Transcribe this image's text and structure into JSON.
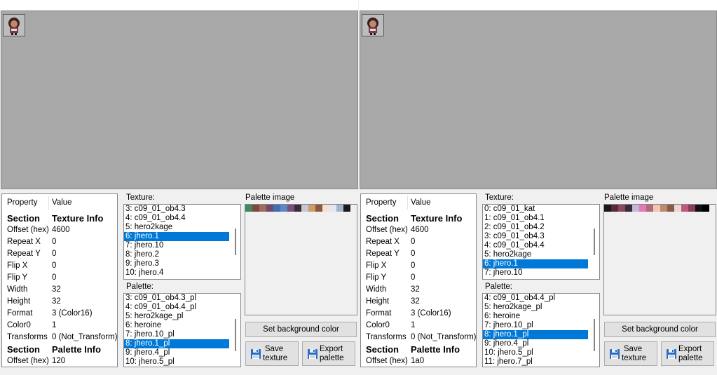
{
  "panes": [
    {
      "properties": {
        "header": {
          "property": "Property",
          "value": "Value"
        },
        "rows": [
          {
            "k": "Section",
            "v": "Texture Info",
            "section": true
          },
          {
            "k": "Offset (hex)",
            "v": "4600"
          },
          {
            "k": "Repeat X",
            "v": "0"
          },
          {
            "k": "Repeat Y",
            "v": "0"
          },
          {
            "k": "Flip X",
            "v": "0"
          },
          {
            "k": "Flip Y",
            "v": "0"
          },
          {
            "k": "Width",
            "v": "32"
          },
          {
            "k": "Height",
            "v": "32"
          },
          {
            "k": "Format",
            "v": "3 (Color16)"
          },
          {
            "k": "Color0",
            "v": "1"
          },
          {
            "k": "Transforms",
            "v": "0 (Not_Transform)"
          },
          {
            "k": "Section",
            "v": "Palette Info",
            "section": true
          },
          {
            "k": "Offset (hex)",
            "v": "120"
          }
        ]
      },
      "texture": {
        "label": "Texture:",
        "items": [
          "3: c09_01_ob4.3",
          "4: c09_01_ob4.4",
          "5: hero2kage",
          "6: jhero.1",
          "7: jhero.10",
          "8: jhero.2",
          "9: jhero.3",
          "10: jhero.4"
        ],
        "selected": 3
      },
      "palette": {
        "label": "Palette:",
        "items": [
          "3: c09_01_ob4.3_pl",
          "4: c09_01_ob4.4_pl",
          "5: hero2kage_pl",
          "6: heroine",
          "7: jhero.10_pl",
          "8: jhero.1_pl",
          "9: jhero.4_pl",
          "10: jhero.5_pl"
        ],
        "selected": 5
      },
      "palette_image": {
        "label": "Palette image",
        "colors": [
          "#3f8a5a",
          "#7b4a3f",
          "#a06a5e",
          "#6f4a6e",
          "#3f70b0",
          "#5d87c5",
          "#7a4f80",
          "#3a2a3a",
          "#c6c6d6",
          "#d19a6c",
          "#8a5a3a",
          "#f4e2d2",
          "#e6e6f0",
          "#a4b4cc",
          "#1a1a1a"
        ]
      },
      "buttons": {
        "set_bg": "Set background color",
        "save_line1": "Save",
        "save_line2": "texture",
        "export_line1": "Export",
        "export_line2": "palette"
      }
    },
    {
      "properties": {
        "header": {
          "property": "Property",
          "value": "Value"
        },
        "rows": [
          {
            "k": "Section",
            "v": "Texture Info",
            "section": true
          },
          {
            "k": "Offset (hex)",
            "v": "4600"
          },
          {
            "k": "Repeat X",
            "v": "0"
          },
          {
            "k": "Repeat Y",
            "v": "0"
          },
          {
            "k": "Flip X",
            "v": "0"
          },
          {
            "k": "Flip Y",
            "v": "0"
          },
          {
            "k": "Width",
            "v": "32"
          },
          {
            "k": "Height",
            "v": "32"
          },
          {
            "k": "Format",
            "v": "3 (Color16)"
          },
          {
            "k": "Color0",
            "v": "1"
          },
          {
            "k": "Transforms",
            "v": "0 (Not_Transform)"
          },
          {
            "k": "Section",
            "v": "Palette Info",
            "section": true
          },
          {
            "k": "Offset (hex)",
            "v": "1a0"
          }
        ]
      },
      "texture": {
        "label": "Texture:",
        "items": [
          "0: c09_01_kat",
          "1: c09_01_ob4.1",
          "2: c09_01_ob4.2",
          "3: c09_01_ob4.3",
          "4: c09_01_ob4.4",
          "5: hero2kage",
          "6: jhero.1",
          "7: jhero.10"
        ],
        "selected": 6
      },
      "palette": {
        "label": "Palette:",
        "items": [
          "4: c09_01_ob4.4_pl",
          "5: hero2kage_pl",
          "6: heroine",
          "7: jhero.10_pl",
          "8: jhero.1_pl",
          "9: jhero.4_pl",
          "10: jhero.5_pl",
          "11: jhero.7_pl"
        ],
        "selected": 4
      },
      "palette_image": {
        "label": "Palette image",
        "colors": [
          "#1a1a1a",
          "#5a2a3a",
          "#8a4a5a",
          "#3a2a3a",
          "#c6b6d6",
          "#e07ab0",
          "#b06a7a",
          "#f0c8b0",
          "#c08a6a",
          "#8a5a4a",
          "#e8d8d8",
          "#c05a7a",
          "#8a3a5a",
          "#101010",
          "#000000"
        ]
      },
      "buttons": {
        "set_bg": "Set background color",
        "save_line1": "Save",
        "save_line2": "texture",
        "export_line1": "Export",
        "export_line2": "palette"
      }
    }
  ]
}
